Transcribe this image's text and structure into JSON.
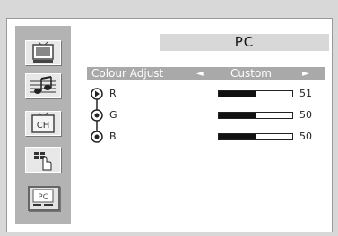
{
  "title": "PC",
  "header": {
    "label": "Colour Adjust",
    "value": "Custom",
    "arrow_left": "◄",
    "arrow_right": "►"
  },
  "sidebar": {
    "icons": [
      "picture-icon",
      "sound-icon",
      "channel-icon",
      "setup-icon",
      "pc-icon"
    ],
    "channel_text": "CH",
    "pc_text": "PC"
  },
  "rows": [
    {
      "label": "R",
      "value": "51",
      "level": 51
    },
    {
      "label": "G",
      "value": "50",
      "level": 50
    },
    {
      "label": "B",
      "value": "50",
      "level": 50
    }
  ],
  "colors": {
    "background": "#d8d8d8",
    "panel": "#ffffff",
    "sidebar": "#b3b3b3",
    "header": "#a9a9a9",
    "title_bar": "#d8d8d8"
  }
}
